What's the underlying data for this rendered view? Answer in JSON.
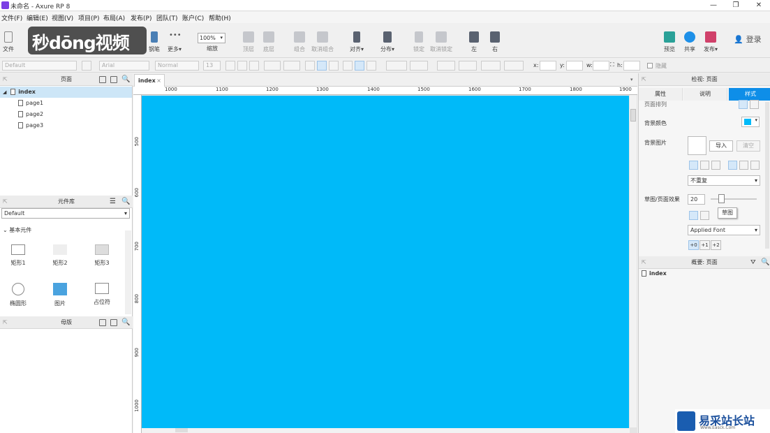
{
  "window": {
    "title": "未命名 - Axure RP 8",
    "minimize": "—",
    "maximize": "❐",
    "close": "✕"
  },
  "menu": [
    "文件(F)",
    "编辑(E)",
    "视图(V)",
    "项目(P)",
    "布局(A)",
    "发布(P)",
    "团队(T)",
    "账户(C)",
    "帮助(H)"
  ],
  "toolbar": {
    "file_label": "文件",
    "pen_label": "钢笔",
    "more_label": "更多▾",
    "zoom_value": "100%",
    "zoom_label": "缩放",
    "top_label": "顶层",
    "bottom_label": "底层",
    "group_label": "组合",
    "ungroup_label": "取消组合",
    "align_label": "对齐▾",
    "distribute_label": "分布▾",
    "lock_label": "锁定",
    "unlock_label": "取消锁定",
    "left_label": "左",
    "right_label": "右",
    "preview_label": "预览",
    "share_label": "共享",
    "publish_label": "发布▾",
    "login_label": "登录"
  },
  "overlay_logo": "秒dōng视频",
  "format": {
    "style": "Default",
    "font": "Arial",
    "weight": "Normal",
    "size": "13",
    "x_label": "x:",
    "y_label": "y:",
    "w_label": "w:",
    "h_label": "h:",
    "hide_label": "隐藏"
  },
  "pages_panel": {
    "title": "页面",
    "items": [
      {
        "label": "index",
        "selected": true
      },
      {
        "label": "page1"
      },
      {
        "label": "page2"
      },
      {
        "label": "page3"
      }
    ]
  },
  "library_panel": {
    "title": "元件库",
    "selected": "Default",
    "section": "基本元件",
    "widgets": [
      "矩形1",
      "矩形2",
      "矩形3",
      "椭圆形",
      "图片",
      "占位符"
    ]
  },
  "masters_panel": {
    "title": "母版"
  },
  "tab": {
    "label": "index",
    "close": "×"
  },
  "ruler": {
    "top": [
      "1000",
      "1100",
      "1200",
      "1300",
      "1400",
      "1500",
      "1600",
      "1700",
      "1800",
      "1900"
    ],
    "left": [
      "500",
      "600",
      "700",
      "800",
      "900",
      "1000"
    ]
  },
  "canvas": {
    "background": "#00baf9"
  },
  "inspector": {
    "title": "检视: 页面",
    "tabs": [
      "属性",
      "说明",
      "样式"
    ],
    "active_tab": "样式",
    "page_arrange_label": "页面排列",
    "bg_color_label": "背景颜色",
    "bg_color": "#00baf9",
    "bg_image_label": "背景图片",
    "import_label": "导入",
    "clear_label": "清空",
    "repeat_value": "不重复",
    "sketch_label": "草图/页面效果",
    "sketch_value": "20",
    "tooltip": "草图",
    "font_value": "Applied Font",
    "width_buttons": [
      "+0",
      "+1",
      "+2"
    ]
  },
  "outline": {
    "title": "概要: 页面",
    "root": "index"
  },
  "watermark": {
    "text": "易采站长站",
    "subtext": "Www.Easck.Com"
  }
}
